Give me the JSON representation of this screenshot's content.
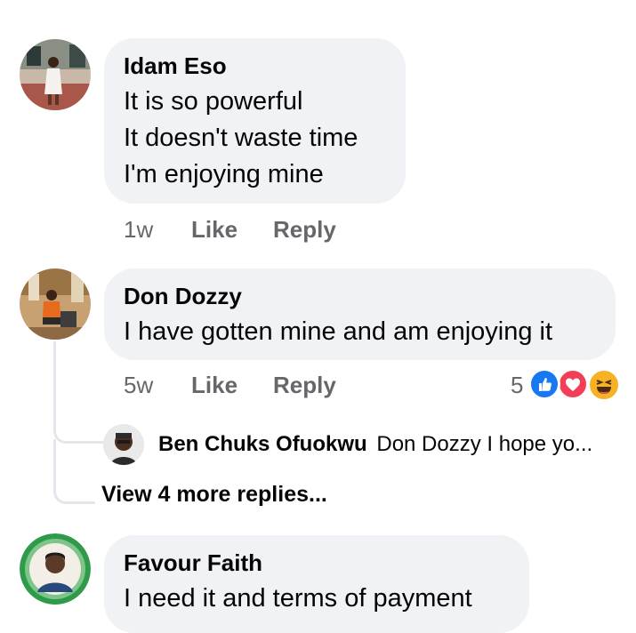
{
  "comments": [
    {
      "author": "Idam Eso",
      "lines": [
        "It is so powerful",
        "It doesn't waste time",
        "I'm enjoying mine"
      ],
      "time": "1w",
      "like": "Like",
      "reply": "Reply"
    },
    {
      "author": "Don Dozzy",
      "lines": [
        "I have gotten mine and am enjoying it"
      ],
      "time": "5w",
      "like": "Like",
      "reply": "Reply",
      "reaction_count": "5",
      "reactions": [
        "like-icon",
        "love-icon",
        "haha-icon"
      ],
      "reply_preview": {
        "author": "Ben Chuks Ofuokwu",
        "text": "Don Dozzy I hope yo..."
      },
      "view_more": "View 4 more replies..."
    },
    {
      "author": "Favour Faith",
      "lines": [
        "I need it and terms of payment"
      ]
    }
  ],
  "colors": {
    "bubble": "#f0f2f5",
    "meta": "#65676b",
    "like_blue": "#1877f2",
    "love_red": "#f33e58",
    "haha_yellow": "#f7b125"
  }
}
